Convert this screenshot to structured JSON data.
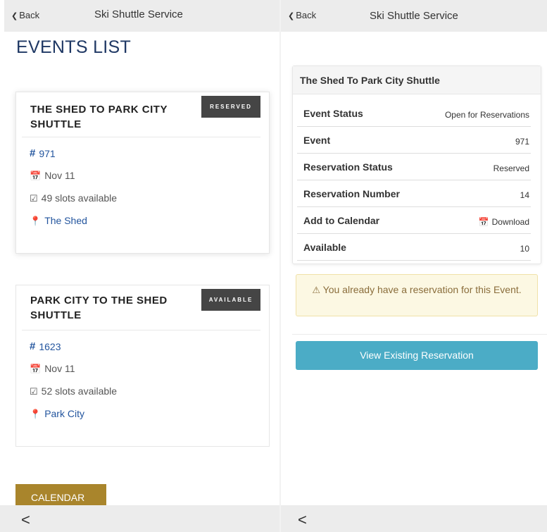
{
  "left": {
    "nav": {
      "back": "Back",
      "title": "Ski Shuttle Service"
    },
    "page_title": "EVENTS LIST",
    "events": [
      {
        "title": "THE SHED TO PARK CITY SHUTTLE",
        "badge": "RESERVED",
        "number": "971",
        "date": "Nov 11",
        "slots": "49 slots available",
        "location": "The Shed"
      },
      {
        "title": "PARK CITY TO THE SHED SHUTTLE",
        "badge": "AVAILABLE",
        "number": "1623",
        "date": "Nov 11",
        "slots": "52 slots available",
        "location": "Park City"
      }
    ],
    "calendar_button": "CALENDAR"
  },
  "right": {
    "nav": {
      "back": "Back",
      "title": "Ski Shuttle Service"
    },
    "panel_title": "The Shed To Park City Shuttle",
    "rows": [
      {
        "label": "Event Status",
        "value": "Open for Reservations"
      },
      {
        "label": "Event",
        "value": "971"
      },
      {
        "label": "Reservation Status",
        "value": "Reserved"
      },
      {
        "label": "Reservation Number",
        "value": "14"
      },
      {
        "label": "Add to Calendar",
        "value": "Download"
      },
      {
        "label": "Available",
        "value": "10"
      }
    ],
    "alert_text": "You already have a reservation for this Event.",
    "view_button": "View Existing Reservation"
  },
  "icons": {
    "back": "chevron-left-icon",
    "hash": "hash-icon",
    "calendar": "calendar-icon",
    "check": "checkbox-icon",
    "location": "map-marker-icon",
    "warning": "warning-icon"
  },
  "colors": {
    "title_blue": "#1f3864",
    "link_blue": "#23559e",
    "badge_dark": "#454545",
    "calendar_gold": "#a9852c",
    "button_teal": "#4bacc6",
    "alert_bg": "#fcf8e3"
  }
}
